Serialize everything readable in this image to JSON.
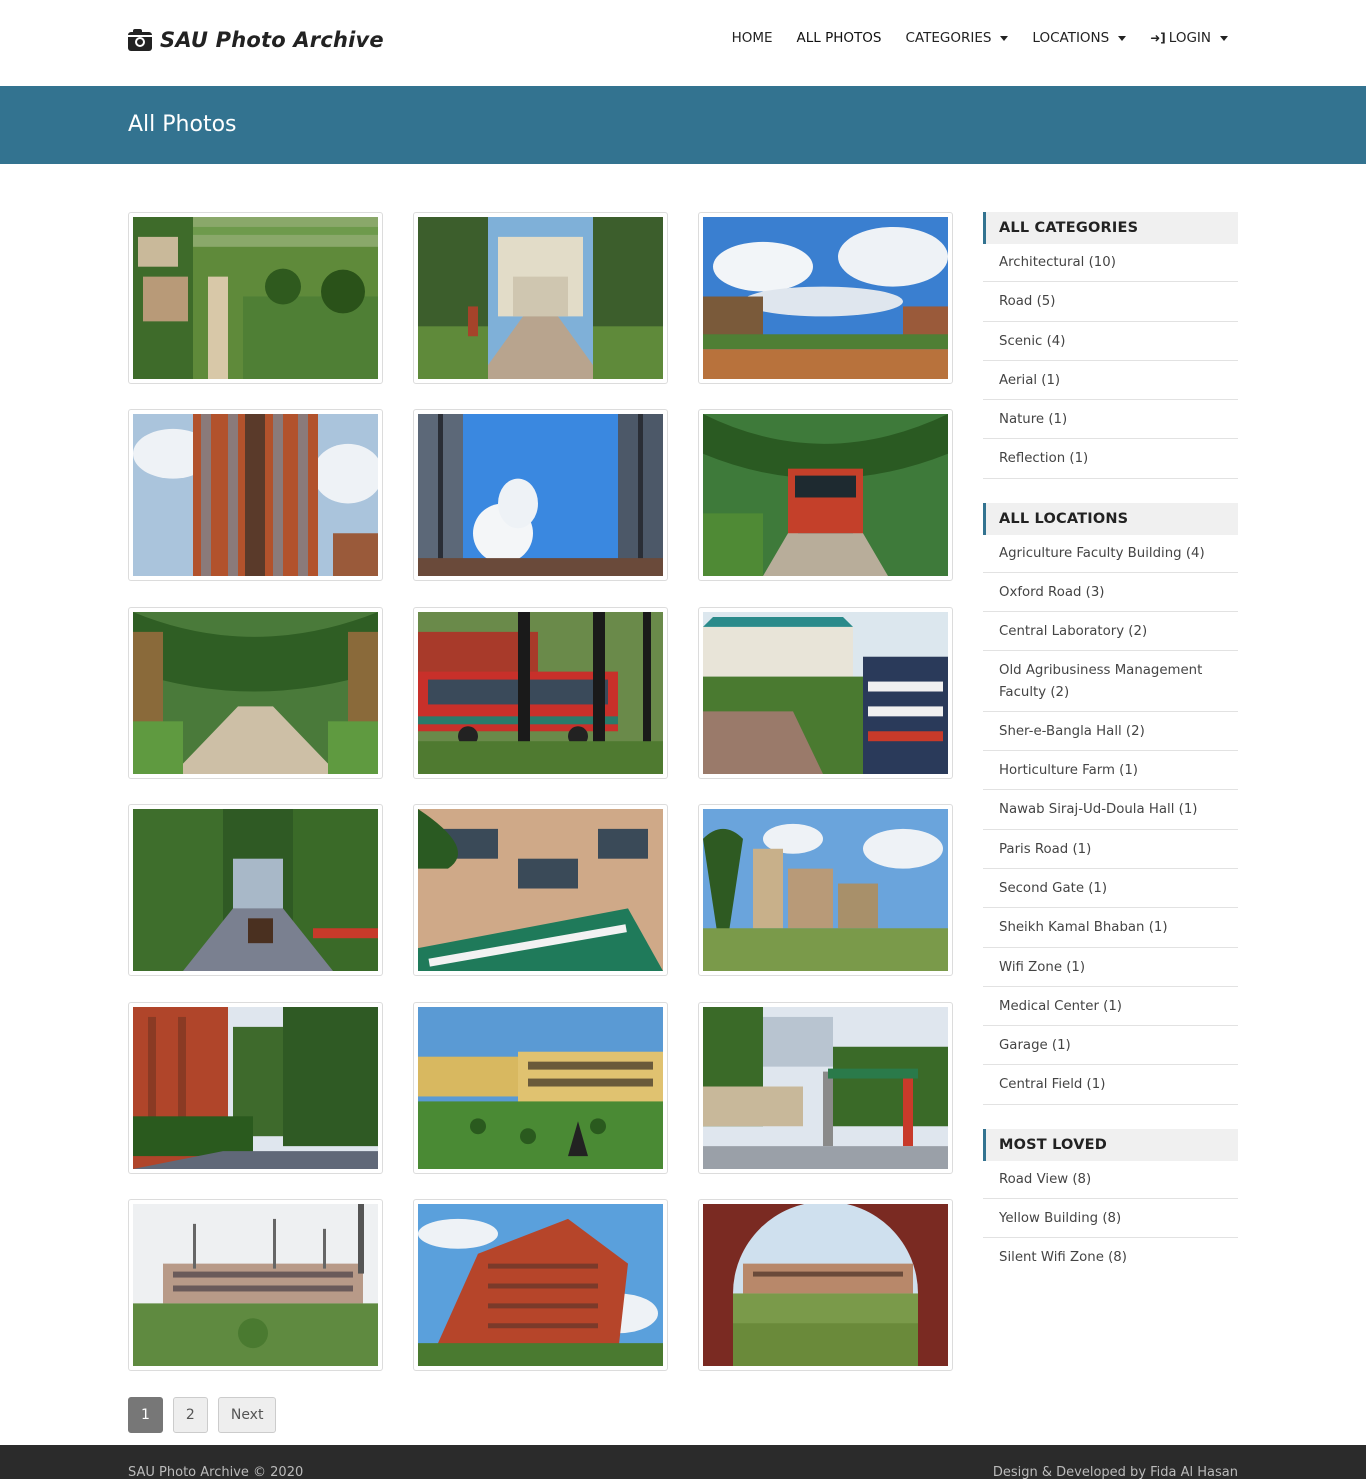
{
  "brand": {
    "title": "SAU Photo Archive",
    "icon": "camera-icon"
  },
  "nav": {
    "home": "HOME",
    "all_photos": "ALL PHOTOS",
    "categories": "CATEGORIES",
    "locations": "LOCATIONS",
    "login": "LOGIN"
  },
  "header": {
    "title": "All Photos"
  },
  "photos": [
    {
      "scene": "aerial-campus"
    },
    {
      "scene": "tree-lined-road-gate"
    },
    {
      "scene": "field-blue-sky"
    },
    {
      "scene": "brick-tower"
    },
    {
      "scene": "sky-between-buildings"
    },
    {
      "scene": "bus-under-palms"
    },
    {
      "scene": "palm-road"
    },
    {
      "scene": "red-bus-garage"
    },
    {
      "scene": "center-sign-building"
    },
    {
      "scene": "rickshaw-tree-road"
    },
    {
      "scene": "research-centre"
    },
    {
      "scene": "palm-buildings-field"
    },
    {
      "scene": "red-building-trees"
    },
    {
      "scene": "yellow-building-garden"
    },
    {
      "scene": "gate-road"
    },
    {
      "scene": "building-towers-grass"
    },
    {
      "scene": "red-highrise"
    },
    {
      "scene": "arch-view"
    }
  ],
  "pagination": {
    "page1": "1",
    "page2": "2",
    "next": "Next"
  },
  "sidebar": {
    "categories_title": "ALL CATEGORIES",
    "categories": [
      "Architectural (10)",
      "Road (5)",
      "Scenic (4)",
      "Aerial (1)",
      "Nature (1)",
      "Reflection (1)"
    ],
    "locations_title": "ALL LOCATIONS",
    "locations": [
      "Agriculture Faculty Building (4)",
      "Oxford Road (3)",
      "Central Laboratory (2)",
      "Old Agribusiness Management Faculty (2)",
      "Sher-e-Bangla Hall (2)",
      "Horticulture Farm (1)",
      "Nawab Siraj-Ud-Doula Hall (1)",
      "Paris Road (1)",
      "Second Gate (1)",
      "Sheikh Kamal Bhaban (1)",
      "Wifi Zone (1)",
      "Medical Center (1)",
      "Garage (1)",
      "Central Field (1)"
    ],
    "loved_title": "MOST LOVED",
    "loved": [
      "Road View (8)",
      "Yellow Building (8)",
      "Silent Wifi Zone (8)"
    ]
  },
  "footer": {
    "left": "SAU Photo Archive © 2020",
    "right": "Design & Developed by Fida Al Hasan"
  },
  "colors": {
    "header_bg": "#337390",
    "footer_bg": "#2b2b2b",
    "accent": "#337390"
  }
}
